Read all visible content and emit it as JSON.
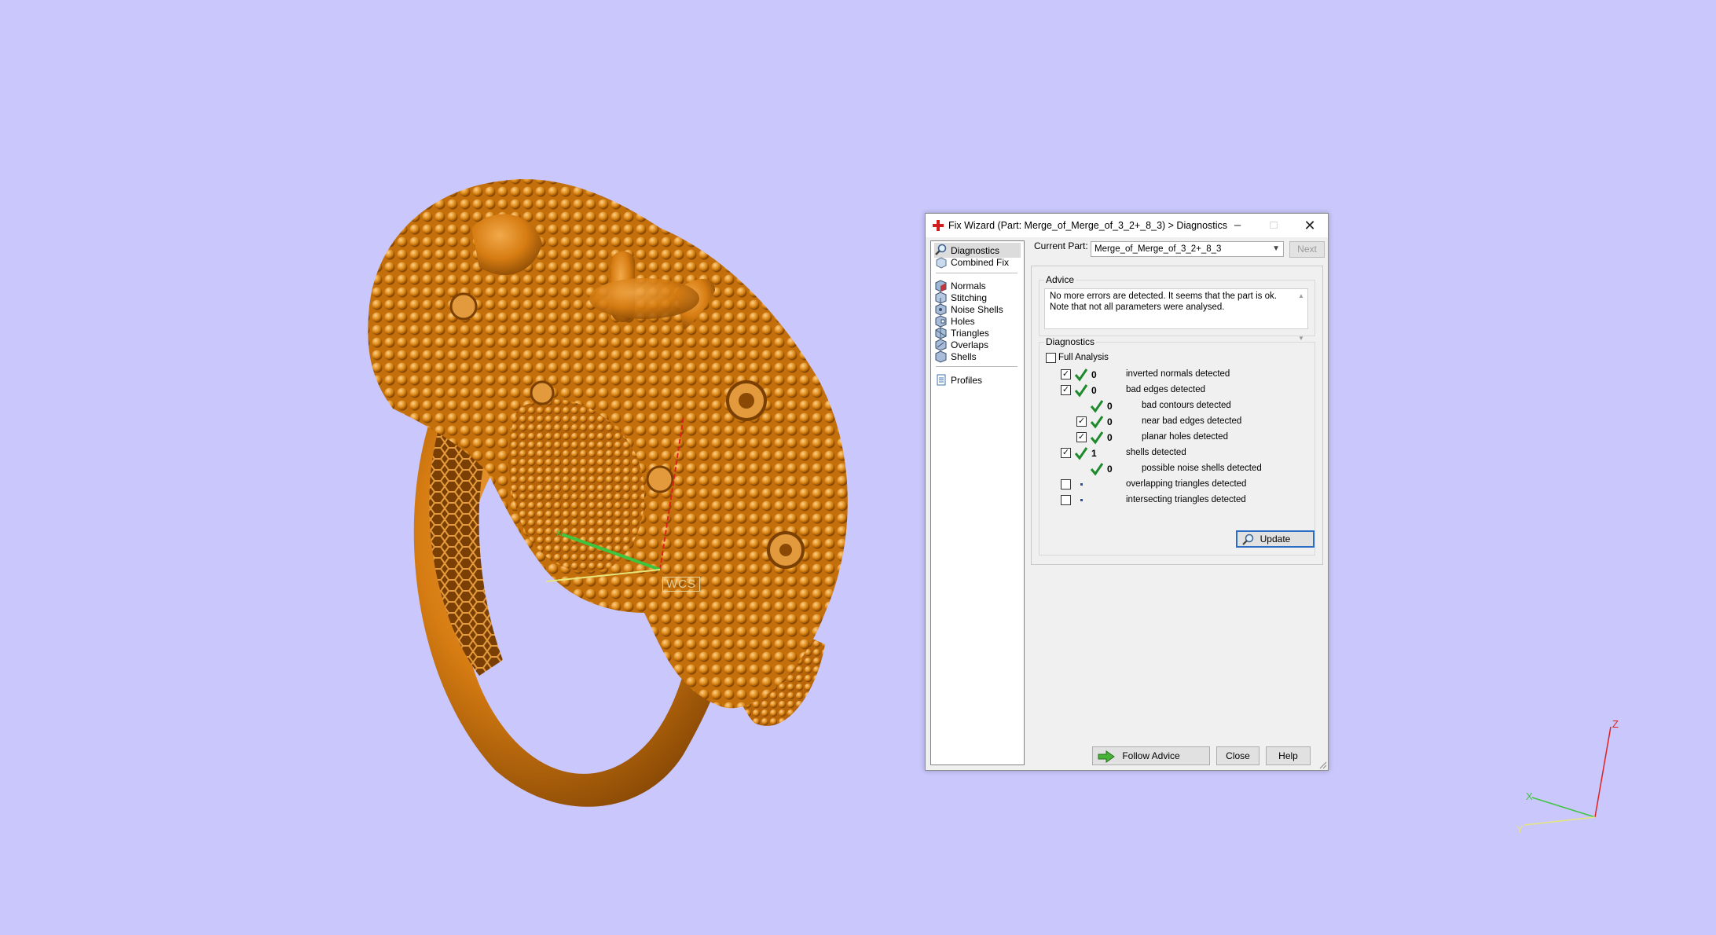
{
  "dialog": {
    "title": "Fix Wizard (Part: Merge_of_Merge_of_3_2+_8_3) > Diagnostics",
    "window_controls": {
      "minimize": "–",
      "maximize": "□",
      "close": "✕"
    },
    "current_part_label": "Current Part:",
    "current_part_value": "Merge_of_Merge_of_3_2+_8_3",
    "next_label": "Next",
    "nav": {
      "items": [
        {
          "label": "Diagnostics",
          "icon": "magnifier-icon",
          "selected": true
        },
        {
          "label": "Combined Fix",
          "icon": "combined-fix-icon"
        },
        {
          "label": "Normals",
          "icon": "normals-cube-icon"
        },
        {
          "label": "Stitching",
          "icon": "stitching-cube-icon"
        },
        {
          "label": "Noise Shells",
          "icon": "noise-shells-cube-icon"
        },
        {
          "label": "Holes",
          "icon": "holes-cube-icon"
        },
        {
          "label": "Triangles",
          "icon": "triangles-cube-icon"
        },
        {
          "label": "Overlaps",
          "icon": "overlaps-cube-icon"
        },
        {
          "label": "Shells",
          "icon": "shells-cube-icon"
        },
        {
          "label": "Profiles",
          "icon": "profiles-document-icon"
        }
      ]
    },
    "advice": {
      "group_label": "Advice",
      "text": "No more errors are detected. It seems that the part is ok. Note that not all parameters were analysed."
    },
    "diagnostics": {
      "group_label": "Diagnostics",
      "full_analysis_label": "Full Analysis",
      "full_analysis_checked": false,
      "rows": [
        {
          "label": "inverted normals detected",
          "count": "0",
          "checked": true,
          "has_checkbox": true,
          "status": "ok",
          "level": 0
        },
        {
          "label": "bad edges detected",
          "count": "0",
          "checked": true,
          "has_checkbox": true,
          "status": "ok",
          "level": 0
        },
        {
          "label": "bad contours detected",
          "count": "0",
          "checked": false,
          "has_checkbox": false,
          "status": "ok",
          "level": 1
        },
        {
          "label": "near bad edges detected",
          "count": "0",
          "checked": true,
          "has_checkbox": true,
          "status": "ok",
          "level": 1
        },
        {
          "label": "planar holes detected",
          "count": "0",
          "checked": true,
          "has_checkbox": true,
          "status": "ok",
          "level": 1
        },
        {
          "label": "shells detected",
          "count": "1",
          "checked": true,
          "has_checkbox": true,
          "status": "ok",
          "level": 0
        },
        {
          "label": "possible noise shells detected",
          "count": "0",
          "checked": false,
          "has_checkbox": false,
          "status": "ok",
          "level": 1
        },
        {
          "label": "overlapping triangles detected",
          "count": "",
          "checked": false,
          "has_checkbox": true,
          "status": "not-analysed",
          "level": 0
        },
        {
          "label": "intersecting triangles detected",
          "count": "",
          "checked": false,
          "has_checkbox": true,
          "status": "not-analysed",
          "level": 0
        }
      ],
      "update_label": "Update"
    },
    "buttons": {
      "follow_advice": "Follow Advice",
      "close": "Close",
      "help": "Help"
    }
  },
  "viewport": {
    "wcs_label": "WCS",
    "axis_labels": {
      "x": "X",
      "y": "Y",
      "z": "Z"
    },
    "colors": {
      "background": "#c9c7fb",
      "model": "#d9860f",
      "x_axis": "#3ec43e",
      "y_axis": "#e6e67a",
      "z_axis": "#e02020"
    }
  }
}
